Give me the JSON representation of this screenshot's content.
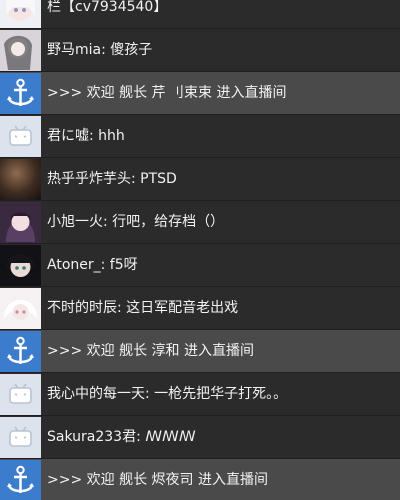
{
  "messages": [
    {
      "kind": "chat",
      "avatar": "anime-girl-avatar",
      "text": "栏【cv7934540】"
    },
    {
      "kind": "chat",
      "avatar": "photo-avatar",
      "text": "野马mia: 傻孩子"
    },
    {
      "kind": "system",
      "avatar": "anchor-badge-icon",
      "text": ">>>  欢迎 舰长 芹 刂束束 进入直播间"
    },
    {
      "kind": "chat",
      "avatar": "default-tv-avatar",
      "text": "君に嘘: hhh"
    },
    {
      "kind": "chat",
      "avatar": "dark-photo-avatar",
      "text": "热乎乎炸芋头: PTSD"
    },
    {
      "kind": "chat",
      "avatar": "anime-girl-avatar",
      "text": "小旭一火: 行吧，给存档（）"
    },
    {
      "kind": "chat",
      "avatar": "black-hair-avatar",
      "text": "Atoner_: f5呀"
    },
    {
      "kind": "chat",
      "avatar": "pale-anime-avatar",
      "text": "不时的时辰: 这日军配音老出戏"
    },
    {
      "kind": "system",
      "avatar": "anchor-badge-icon",
      "text": ">>>  欢迎 舰长 淳和 进入直播间"
    },
    {
      "kind": "chat",
      "avatar": "default-tv-avatar",
      "text": "我心中的每一天: 一枪先把华子打死。。"
    },
    {
      "kind": "chat",
      "avatar": "default-tv-avatar",
      "text": "Sakura233君: ꟿꟿꟿ"
    },
    {
      "kind": "system",
      "avatar": "anchor-badge-icon",
      "text": ">>>  欢迎 舰长 烬夜司 进入直播间"
    }
  ]
}
